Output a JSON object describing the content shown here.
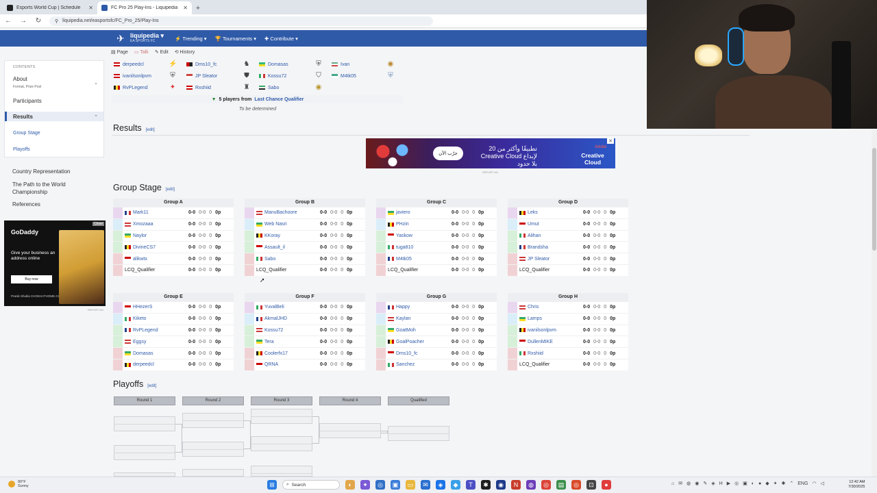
{
  "browser": {
    "tabs": [
      {
        "title": "Esports World Cup | Schedule",
        "active": false
      },
      {
        "title": "FC Pro 25 Play-Ins - Liquipedia",
        "active": true
      }
    ],
    "url": "liquipedia.net/easportsfc/FC_Pro_25/Play-Ins"
  },
  "site": {
    "brand": "liquipedia",
    "sub": "EA SPORTS FC",
    "menu": [
      "Trending",
      "Tournaments",
      "Contribute"
    ],
    "actions": [
      "Page",
      "Talk",
      "Edit",
      "History"
    ]
  },
  "sidebar": {
    "contents_label": "CONTENTS",
    "items": [
      {
        "label": "About",
        "sub": "Format, Prize Pool"
      },
      {
        "label": "Participants"
      },
      {
        "label": "Results"
      }
    ],
    "results_sub": [
      "Group Stage",
      "Playoffs"
    ],
    "other": [
      "Country Representation",
      "The Path to the World Championship",
      "References"
    ]
  },
  "gd_ad": {
    "logo": "GoDaddy",
    "text": "Give your business an address online",
    "button": "Buy now",
    "small": "Pranik Shukla\nCHOKHATHOME.COM",
    "close": "Close",
    "report": "REPORT AD"
  },
  "qualified": {
    "rows": [
      [
        "derpeedcl",
        "Dms10_fc",
        "Domasas",
        "Ivan"
      ],
      [
        "ivanilsonlpvm",
        "JP Sleator",
        "Kossu72",
        "M4tk05"
      ],
      [
        "RvPLegend",
        "Rxshiid",
        "Sabo",
        ""
      ]
    ],
    "lcq_text": "5 players from",
    "lcq_link": "Last Chance Qualifier",
    "tbd": "To be determined"
  },
  "results": {
    "title": "Results",
    "edit": "[edit]"
  },
  "adobe_ad": {
    "cta": "جرّب الآن",
    "arabic": "20 تطبيقًا وأكثر من Creative Cloud لإبداع بلا حدود",
    "cc": "Creative Cloud",
    "brand": "Adobe",
    "report": "REPORT AD"
  },
  "group_stage": {
    "title": "Group Stage",
    "edit": "[edit]"
  },
  "groups": [
    {
      "name": "Group A",
      "players": [
        "Mark11",
        "Xmozaaa",
        "Naylor",
        "DivineCS7",
        "alikwtx",
        "LCQ_Qualifier"
      ]
    },
    {
      "name": "Group B",
      "players": [
        "ManuBachoore",
        "Web Nasri",
        "KKoray",
        "Assault_il",
        "Sabo",
        "LCQ_Qualifier"
      ]
    },
    {
      "name": "Group C",
      "players": [
        "javiero",
        "PHzin",
        "Yaskow",
        "tuga810",
        "M4tk05",
        "LCQ_Qualifier"
      ]
    },
    {
      "name": "Group D",
      "players": [
        "Leks",
        "Umut",
        "Alihan",
        "Brandsha",
        "JP Sleator",
        "LCQ_Qualifier"
      ]
    },
    {
      "name": "Group E",
      "players": [
        "HHezerS",
        "Kiketo",
        "RvPLegend",
        "Eggsy",
        "Domasas",
        "derpeedcl"
      ]
    },
    {
      "name": "Group F",
      "players": [
        "YuvalBeli",
        "AkmalJHD",
        "Kossu72",
        "Tera",
        "Coolerfx17",
        "QRNA"
      ]
    },
    {
      "name": "Group G",
      "players": [
        "Happy",
        "Kaylan",
        "GoatMoh",
        "GoalPoacher",
        "Dms10_fc",
        "Sanchez"
      ]
    },
    {
      "name": "Group H",
      "players": [
        "Chris",
        "Lamps",
        "ivanilsonlpvm",
        "DullenMIKE",
        "Rxshiid",
        "LCQ_Qualifier"
      ]
    }
  ],
  "stats": {
    "record": "0-0",
    "games": "0-0",
    "diff": "0",
    "points": "0p"
  },
  "playoffs": {
    "title": "Playoffs",
    "edit": "[edit]",
    "rounds": [
      "Round 1",
      "Round 2",
      "Round 3",
      "Round 4",
      "Qualified"
    ]
  },
  "taskbar": {
    "weather_temp": "90°F",
    "weather_desc": "Sunny",
    "search": "Search",
    "lang": "ENG",
    "time": "12:42 AM",
    "date": "7/30/2025"
  }
}
